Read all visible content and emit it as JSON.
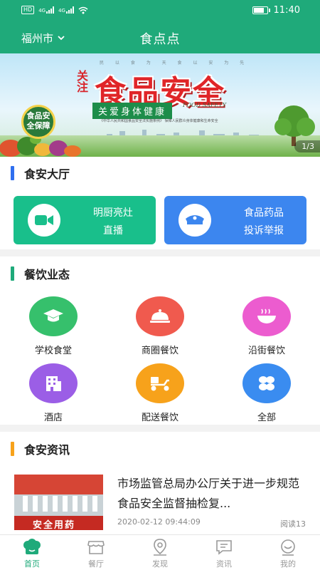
{
  "status_bar": {
    "left_tags": [
      "HD",
      "4G",
      "4G"
    ],
    "time": "11:40"
  },
  "header": {
    "city": "福州市",
    "title": "食点点"
  },
  "banner": {
    "top_line": "民 以 食 为 天 食 以 安 为 先",
    "attention": "关注",
    "headline": "食品安全",
    "subline": "关爱身体健康",
    "food_safety_en": "FOOD SAFETY",
    "note": "《中华人民共和国食品安全法实施条例》 保障人民群众身体健康和生命安全",
    "badge": "食品安全保障",
    "pager": "1/3"
  },
  "hall": {
    "title": "食安大厅",
    "bar_color": "#2f6fef",
    "cards": [
      {
        "line1": "明厨亮灶",
        "line2": "直播",
        "color": "#19bf8b",
        "icon": "video-camera-icon"
      },
      {
        "line1": "食品药品",
        "line2": "投诉举报",
        "color": "#3c86ef",
        "icon": "police-cap-icon"
      }
    ]
  },
  "catering": {
    "title": "餐饮业态",
    "bar_color": "#1faa7a",
    "items": [
      {
        "label": "学校食堂",
        "color": "#36c06c",
        "icon": "graduation-cap-icon"
      },
      {
        "label": "商圈餐饮",
        "color": "#f05a4e",
        "icon": "food-cloche-icon"
      },
      {
        "label": "沿街餐饮",
        "color": "#ec5ccf",
        "icon": "noodle-bowl-icon"
      },
      {
        "label": "酒店",
        "color": "#9b5ee6",
        "icon": "hotel-building-icon"
      },
      {
        "label": "配送餐饮",
        "color": "#f7a21b",
        "icon": "delivery-scooter-icon"
      },
      {
        "label": "全部",
        "color": "#3a8cf0",
        "icon": "all-grid-icon"
      }
    ]
  },
  "news": {
    "title": "食安资讯",
    "bar_color": "#f7a21b",
    "items": [
      {
        "title": "市场监管总局办公厅关于进一步规范食品安全监督抽检复...",
        "date": "2020-02-12 09:44:09",
        "reads": "阅读13",
        "image_caption": "安全用药"
      }
    ]
  },
  "tabbar": {
    "active_color": "#1faa7a",
    "tabs": [
      {
        "label": "首页",
        "icon": "home-chef-icon",
        "active": true
      },
      {
        "label": "餐厅",
        "icon": "restaurant-icon",
        "active": false
      },
      {
        "label": "发现",
        "icon": "location-pin-icon",
        "active": false
      },
      {
        "label": "资讯",
        "icon": "message-icon",
        "active": false
      },
      {
        "label": "我的",
        "icon": "smiley-profile-icon",
        "active": false
      }
    ]
  }
}
